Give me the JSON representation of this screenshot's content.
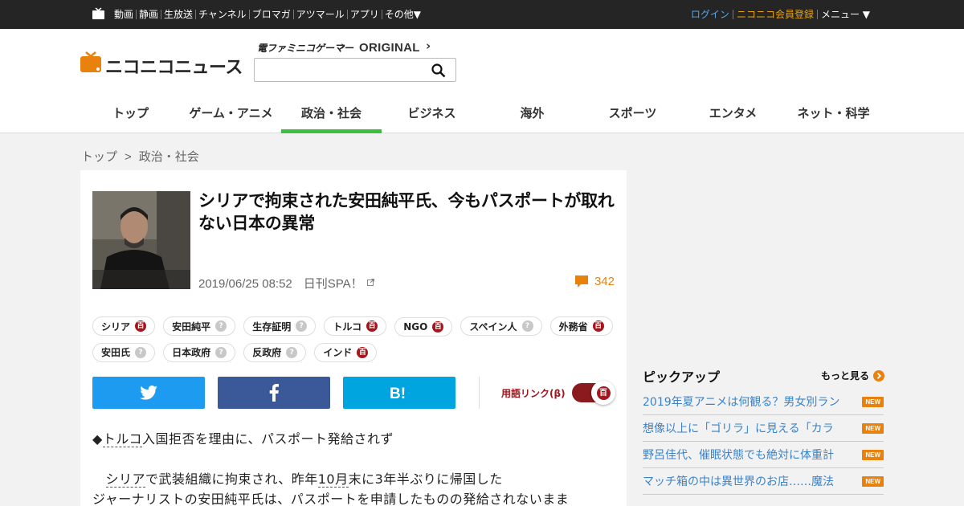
{
  "topbar": {
    "nav": [
      "動画",
      "静画",
      "生放送",
      "チャンネル",
      "ブロマガ",
      "アツマール",
      "アプリ",
      "その他▼"
    ],
    "login": "ログイン",
    "register": "ニコニコ会員登録",
    "menu": "メニュー ▼"
  },
  "header": {
    "logo_text": "ニコニコニュース",
    "famitsu": "電ファミニコゲーマー",
    "original": "ORIGINAL",
    "search_value": "",
    "categories": [
      "トップ",
      "ゲーム・アニメ",
      "政治・社会",
      "ビジネス",
      "海外",
      "スポーツ",
      "エンタメ",
      "ネット・科学"
    ],
    "active_category_index": 2,
    "active_color": "#3cbf3c"
  },
  "breadcrumb": {
    "home": "トップ",
    "separator": ">",
    "current": "政治・社会"
  },
  "article": {
    "title": "シリアで拘束された安田純平氏、今もパスポートが取れない日本の異常",
    "datetime": "2019/06/25 08:52",
    "source": "日刊SPA！",
    "comment_count": "342",
    "tags": [
      {
        "label": "シリア",
        "dic": "red"
      },
      {
        "label": "安田純平",
        "dic": "gray"
      },
      {
        "label": "生存証明",
        "dic": "gray"
      },
      {
        "label": "トルコ",
        "dic": "red"
      },
      {
        "label": "NGO",
        "dic": "red"
      },
      {
        "label": "スペイン人",
        "dic": "gray"
      },
      {
        "label": "外務省",
        "dic": "red"
      },
      {
        "label": "安田氏",
        "dic": "gray"
      },
      {
        "label": "日本政府",
        "dic": "gray"
      },
      {
        "label": "反政府",
        "dic": "gray"
      },
      {
        "label": "インド",
        "dic": "red"
      }
    ],
    "term_link_label": "用語リンク(β)",
    "body": {
      "heading_marker": "◆",
      "heading_link": "トルコ",
      "heading_rest": "入国拒否を理由に、パスポート発給されず",
      "p1_link1": "シリア",
      "p1_text1": "で武装組織に拘束され、昨年",
      "p1_link2": "10月",
      "p1_text2": "末に3年半ぶりに帰国した",
      "p1_line2": "ジャーナリストの安田純平氏は、パスポートを申請したものの発給されないまま"
    }
  },
  "pickup": {
    "heading": "ピックアップ",
    "more": "もっと見る",
    "items": [
      "2019年夏アニメは何観る？男女別ラン",
      "想像以上に「ゴリラ」に見える「カラ",
      "野呂佳代、催眠状態でも絶対に体重計",
      "マッチ箱の中は異世界のお店……魔法"
    ],
    "badge": "NEW"
  },
  "colors": {
    "brand_orange": "#e8820c",
    "twitter": "#1d9bf0",
    "facebook": "#3b5998",
    "hatena": "#00a4de",
    "dic_red": "#a4161c"
  }
}
